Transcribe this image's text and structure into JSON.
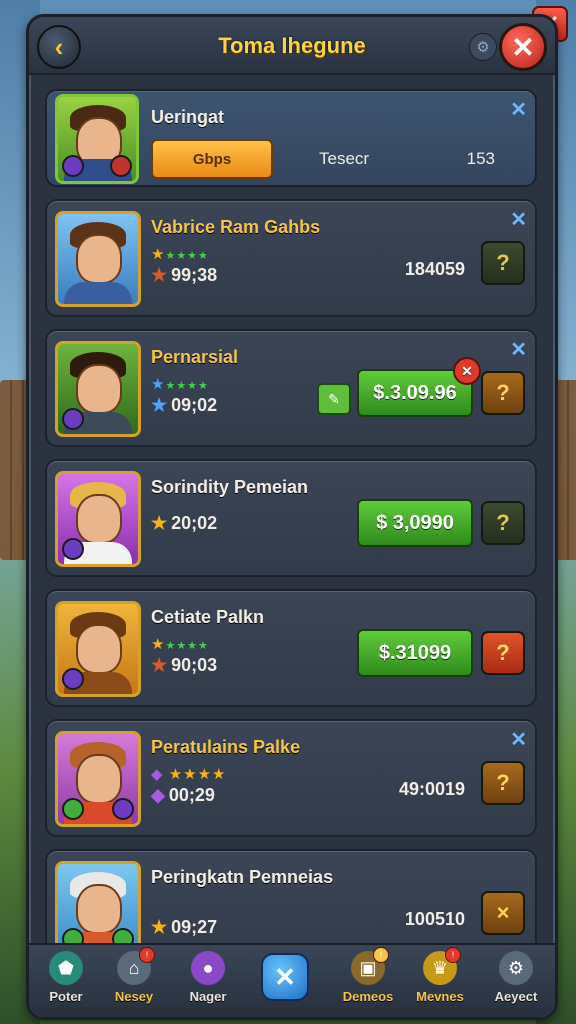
{
  "header": {
    "title": "Toma Ihegune"
  },
  "first_card": {
    "name": "Ueringat",
    "tab_label": "Gbps",
    "tab_text": "Tesecr",
    "tab_number": "153"
  },
  "cards": [
    {
      "name": "Vabrice Ram Gahbs",
      "rating": "99;38",
      "score": "184059",
      "question": "?"
    },
    {
      "name": "Pernarsial",
      "rating": "09;02",
      "price": "$.3.09.96",
      "question": "?"
    },
    {
      "name": "Sorindity Pemeian",
      "rating": "20;02",
      "price": "$ 3,0990",
      "question": "?"
    },
    {
      "name": "Cetiate Palkn",
      "rating": "90;03",
      "price": "$.31099",
      "question": "?"
    },
    {
      "name": "Peratulains Palke",
      "rating": "00;29",
      "score": "49:0019",
      "question": "?"
    },
    {
      "name": "Peringkatn Pemneias",
      "rating": "09;27",
      "score": "100510",
      "question": "×"
    }
  ],
  "nav": [
    {
      "label": "Poter",
      "icon": "gem-icon"
    },
    {
      "label": "Nesey",
      "icon": "house-icon"
    },
    {
      "label": "Nager",
      "icon": "purple-orb-icon"
    },
    {
      "label": "Demeos",
      "icon": "chest-icon"
    },
    {
      "label": "Mevnes",
      "icon": "gold-icon"
    },
    {
      "label": "Aeyect",
      "icon": "gear-icon"
    }
  ],
  "colors": {
    "accent": "#f4c54a",
    "price_green": "#4fb52c",
    "close_red": "#e0392c"
  }
}
